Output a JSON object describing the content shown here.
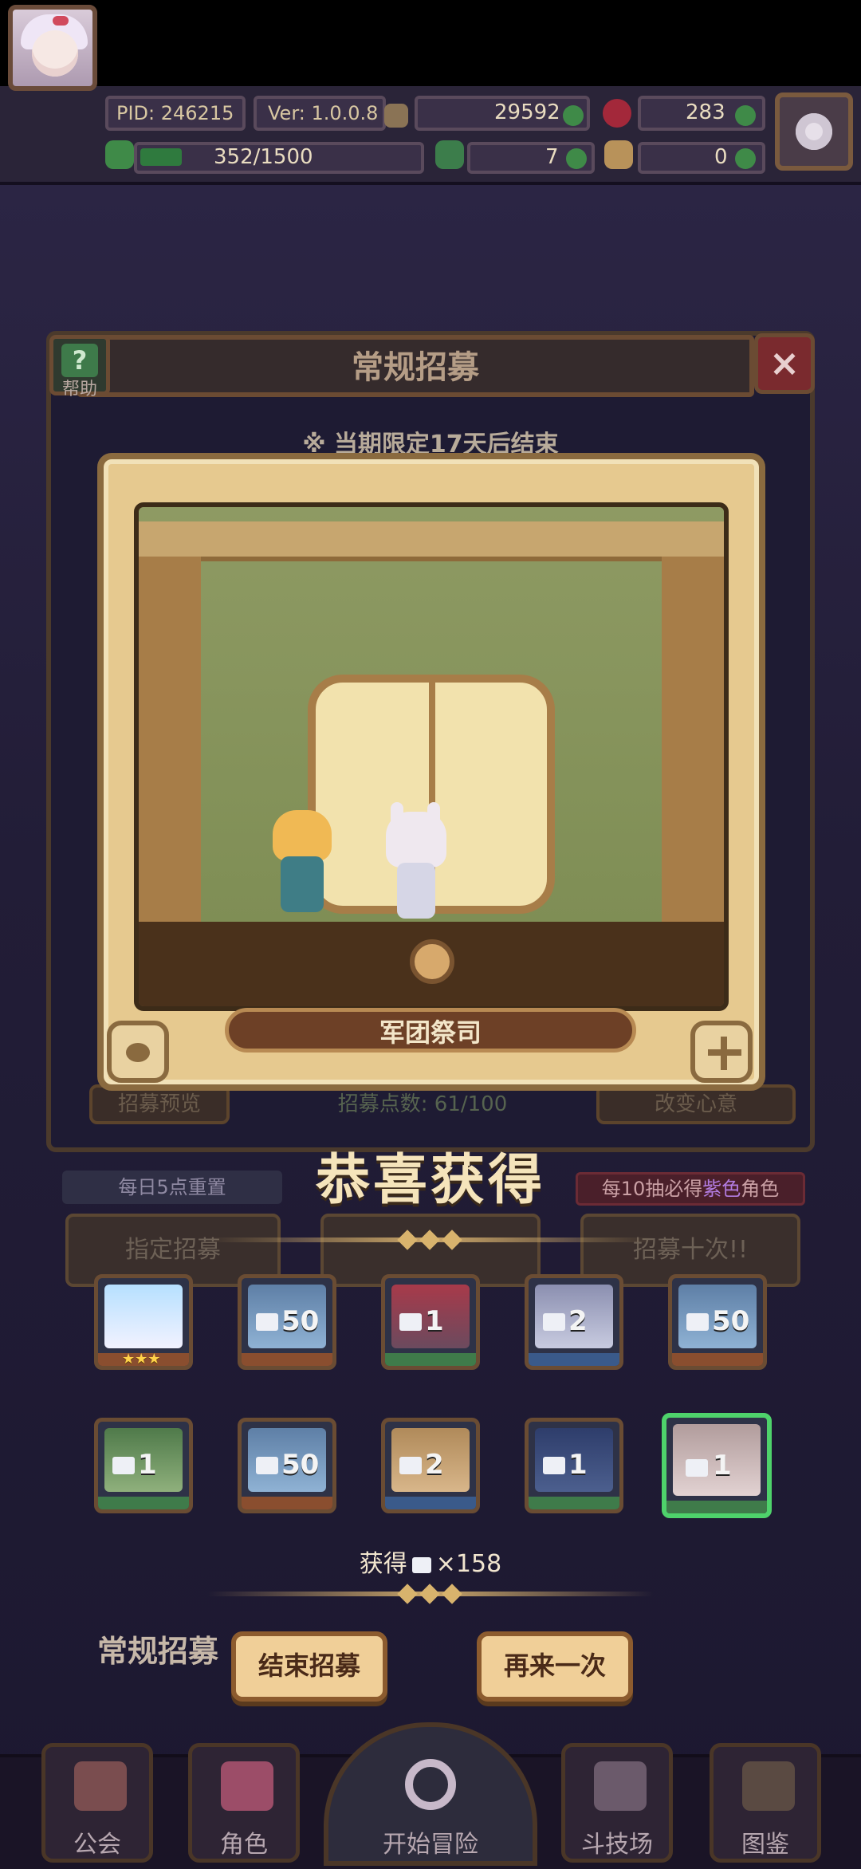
{
  "header": {
    "pid": "PID: 246215",
    "version": "Ver: 1.0.0.8",
    "gold": "29592",
    "gems": "283",
    "stamina": "352/1500",
    "clover": "7",
    "item": "0"
  },
  "panel": {
    "title": "常规招募",
    "help_label": "帮助",
    "period_note": "※ 当期限定17天后结束"
  },
  "card": {
    "name": "军团祭司"
  },
  "background": {
    "preview_label": "招募预览",
    "points": "招募点数: 61/100",
    "change_label": "改变心意",
    "assign_label": "指定招募",
    "ten_label": "招募十次!!",
    "normal_title": "常规招募"
  },
  "result": {
    "title": "恭喜获得",
    "daily_reset": "每日5点重置",
    "ten_guarantee_prefix": "每10抽必得",
    "ten_guarantee_purple": "紫色",
    "ten_guarantee_suffix": "角色",
    "items": [
      {
        "count": "",
        "stars": "★★★"
      },
      {
        "count": "50"
      },
      {
        "count": "1"
      },
      {
        "count": "2"
      },
      {
        "count": "50"
      },
      {
        "count": "1"
      },
      {
        "count": "50"
      },
      {
        "count": "2"
      },
      {
        "count": "1"
      },
      {
        "count": "1"
      }
    ],
    "obtain_prefix": "获得",
    "obtain_amount": "×158",
    "end_button": "结束招募",
    "again_button": "再来一次"
  },
  "nav": {
    "guild": "公会",
    "role": "角色",
    "adventure": "开始冒险",
    "arena": "斗技场",
    "codex": "图鉴"
  },
  "colors": {
    "selected_border": "#4ed26b",
    "purple": "#b27ce0"
  }
}
